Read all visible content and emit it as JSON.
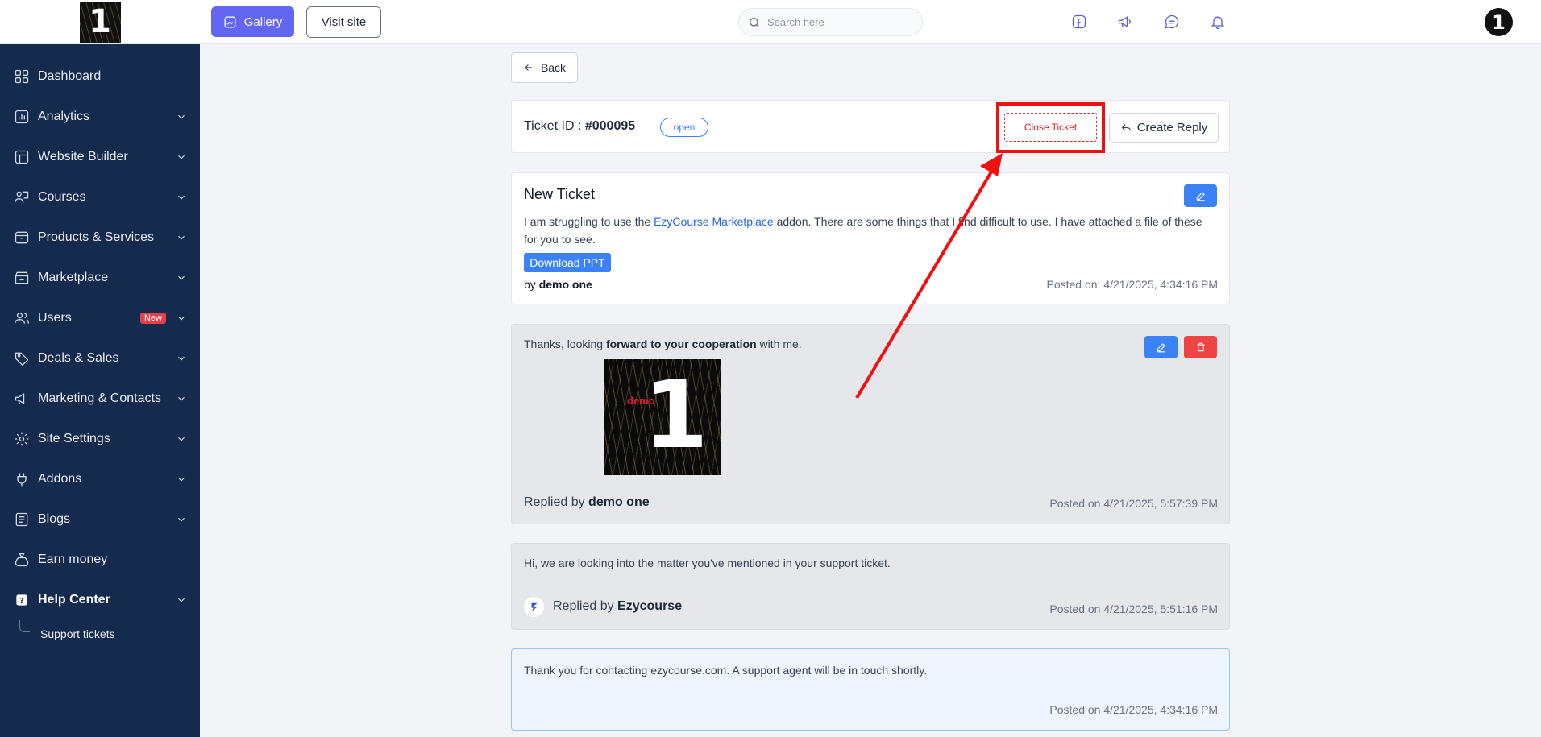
{
  "sidebar": {
    "items": [
      {
        "label": "Dashboard",
        "icon": "grid-icon",
        "has_chevron": false
      },
      {
        "label": "Analytics",
        "icon": "bar-chart-icon",
        "has_chevron": true
      },
      {
        "label": "Website Builder",
        "icon": "layout-icon",
        "has_chevron": true
      },
      {
        "label": "Courses",
        "icon": "teacher-icon",
        "has_chevron": true
      },
      {
        "label": "Products & Services",
        "icon": "box-icon",
        "has_chevron": true
      },
      {
        "label": "Marketplace",
        "icon": "store-icon",
        "has_chevron": true
      },
      {
        "label": "Users",
        "icon": "users-icon",
        "has_chevron": true,
        "badge": "New"
      },
      {
        "label": "Deals & Sales",
        "icon": "tag-icon",
        "has_chevron": true
      },
      {
        "label": "Marketing & Contacts",
        "icon": "megaphone-icon",
        "has_chevron": true
      },
      {
        "label": "Site Settings",
        "icon": "gear-icon",
        "has_chevron": true
      },
      {
        "label": "Addons",
        "icon": "plug-icon",
        "has_chevron": true
      },
      {
        "label": "Blogs",
        "icon": "document-icon",
        "has_chevron": true
      },
      {
        "label": "Earn money",
        "icon": "money-bag-icon",
        "has_chevron": false
      },
      {
        "label": "Help Center",
        "icon": "help-icon",
        "has_chevron": true,
        "active": true
      }
    ],
    "sub_item": "Support tickets"
  },
  "header": {
    "gallery_label": "Gallery",
    "visit_site_label": "Visit site",
    "search_placeholder": "Search here",
    "icons": [
      "facebook-icon",
      "megaphone-icon",
      "chat-icon",
      "bell-icon"
    ],
    "accent": "#6366f1"
  },
  "main": {
    "back_label": "Back",
    "ticket": {
      "id_label": "Ticket ID : ",
      "id": "#000095",
      "status": "open",
      "close_label": "Close Ticket",
      "reply_label": "Create Reply"
    },
    "original": {
      "title": "New Ticket",
      "text_before": "I am struggling to use the ",
      "link_text": "EzyCourse Marketplace",
      "text_after": " addon. There are some things that I find difficult to use. I have attached a file of these for you to see.",
      "download_label": "Download PPT",
      "by_prefix": "by ",
      "by_name": "demo one",
      "posted": "Posted on: 4/21/2025, 4:34:16 PM"
    },
    "replies": [
      {
        "text_before": "Thanks, looking ",
        "text_bold": "forward to your cooperation",
        "text_after": " with me.",
        "image_text": "demo",
        "image_number": "1",
        "by_prefix": "Replied by ",
        "by_name": "demo one",
        "posted": "Posted on 4/21/2025, 5:57:39 PM"
      },
      {
        "text": "Hi, we are looking into the matter you've mentioned in your support ticket.",
        "by_prefix": "Replied by ",
        "by_name": "Ezycourse",
        "posted": "Posted on 4/21/2025, 5:51:16 PM"
      },
      {
        "text": "Thank you for contacting ezycourse.com. A support agent will be in touch shortly.",
        "posted": "Posted on 4/21/2025, 4:34:16 PM"
      }
    ]
  },
  "colors": {
    "sidebar_bg": "#142b4d",
    "primary_blue": "#3b82f6",
    "danger_red": "#ef4444",
    "annotation_red": "#ef1010"
  }
}
